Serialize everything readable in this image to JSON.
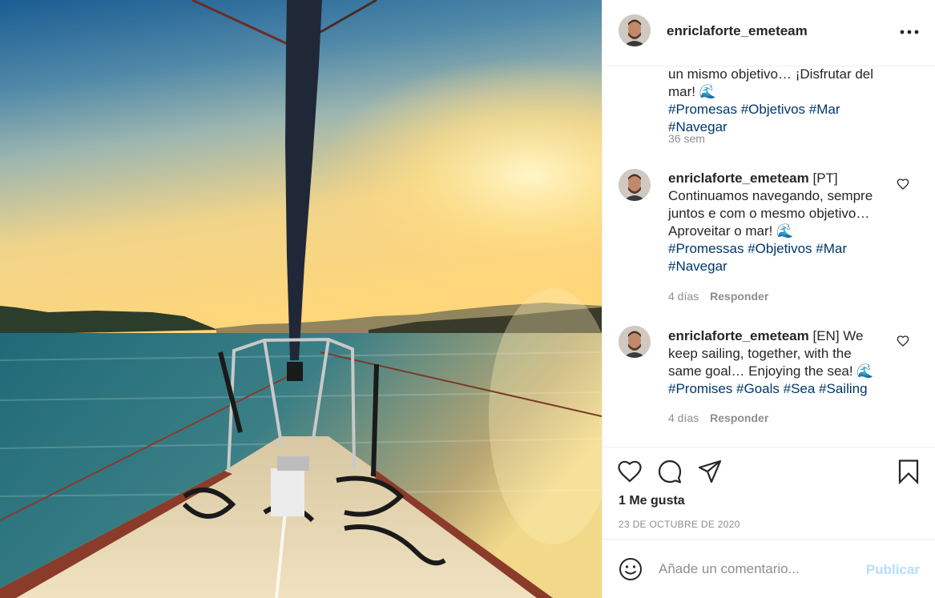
{
  "header": {
    "username": "enriclaforte_emeteam",
    "more_icon": "ellipsis-icon"
  },
  "comments": {
    "caption": {
      "line1": "un mismo objetivo… ¡Disfrutar del",
      "line2": "mar! ",
      "emoji": "🌊",
      "hashtags": "#Promesas #Objetivos #Mar #Navegar",
      "time": "36 sem"
    },
    "items": [
      {
        "username": "enriclaforte_emeteam",
        "l1": " [PT]",
        "l2": "Continuamos navegando, sempre",
        "l3": "juntos e com o mesmo objetivo…",
        "l4": "Aproveitar o mar! ",
        "emoji": "🌊",
        "tags1": "#Promessas #Objetivos #Mar",
        "tags2": "#Navegar",
        "time": "4 días",
        "reply": "Responder"
      },
      {
        "username": "enriclaforte_emeteam",
        "l1": " [EN] We",
        "l2": "keep sailing, together, with the",
        "l3": "same goal… Enjoying the sea! ",
        "emoji": "🌊",
        "tags1": "#Promises #Goals #Sea #Sailing",
        "time": "4 días",
        "reply": "Responder"
      }
    ]
  },
  "actions": {
    "likes": "1 Me gusta",
    "date": "23 DE OCTUBRE DE 2020"
  },
  "add_comment": {
    "placeholder": "Añade un comentario...",
    "publish": "Publicar"
  },
  "colors": {
    "hashtag": "#00376b",
    "muted": "#8e8e8e",
    "publish_disabled": "#b2dffc"
  }
}
